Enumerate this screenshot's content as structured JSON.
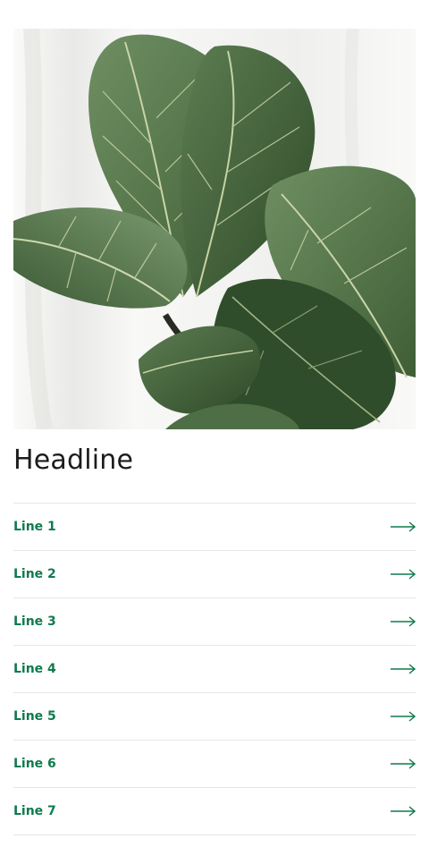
{
  "hero": {
    "image_subject": "fiddle-leaf-fig-plant"
  },
  "headline": "Headline",
  "accent_color": "#0f7a4d",
  "list": {
    "items": [
      {
        "label": "Line 1",
        "icon": "arrow-right-icon"
      },
      {
        "label": "Line 2",
        "icon": "arrow-right-icon"
      },
      {
        "label": "Line 3",
        "icon": "arrow-right-icon"
      },
      {
        "label": "Line 4",
        "icon": "arrow-right-icon"
      },
      {
        "label": "Line 5",
        "icon": "arrow-right-icon"
      },
      {
        "label": "Line 6",
        "icon": "arrow-right-icon"
      },
      {
        "label": "Line 7",
        "icon": "arrow-right-icon"
      }
    ]
  }
}
